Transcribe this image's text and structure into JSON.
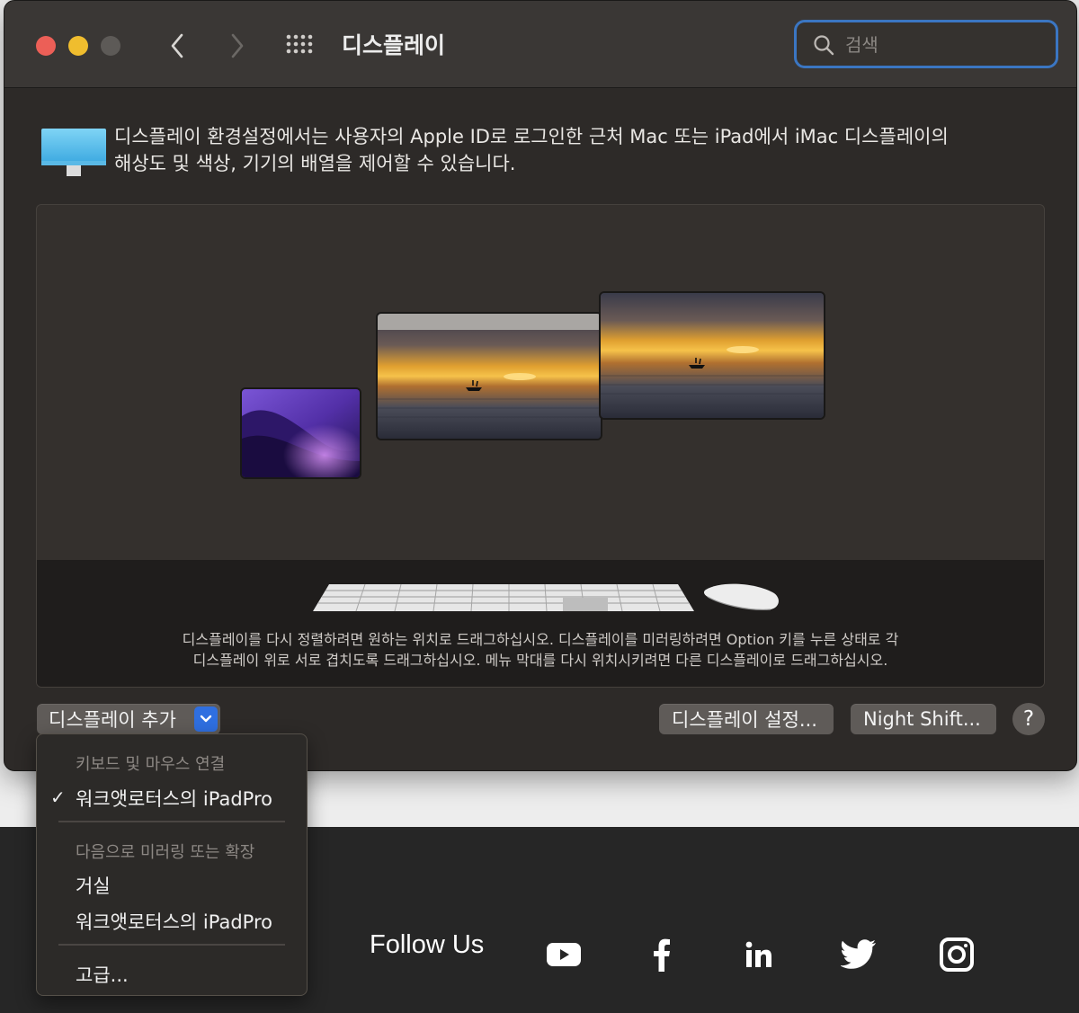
{
  "window": {
    "title": "디스플레이",
    "search_placeholder": "검색"
  },
  "description": {
    "line1": "디스플레이 환경설정에서는 사용자의 Apple ID로 로그인한 근처 Mac 또는 iPad에서 iMac 디스플레이의",
    "line2": "해상도 및 색상, 기기의 배열을 제어할 수 있습니다."
  },
  "arrangement": {
    "hint_line1": "디스플레이를 다시 정렬하려면 원하는 위치로 드래그하십시오. 디스플레이를 미러링하려면 Option 키를 누른 상태로 각",
    "hint_line2": "디스플레이 위로 서로 겹치도록 드래그하십시오. 메뉴 막대를 다시 위치시키려면 다른 디스플레이로 드래그하십시오."
  },
  "buttons": {
    "add_display": "디스플레이 추가",
    "display_settings": "디스플레이 설정...",
    "night_shift": "Night Shift...",
    "help": "?"
  },
  "menu": {
    "section1_header": "키보드 및 마우스 연결",
    "section1_items": [
      "워크앳로터스의 iPadPro"
    ],
    "section1_checked_index": 0,
    "section2_header": "다음으로 미러링 또는 확장",
    "section2_items": [
      "거실",
      "워크앳로터스의 iPadPro"
    ],
    "advanced": "고급..."
  },
  "footer": {
    "follow_us": "Follow Us",
    "socials": [
      "youtube-icon",
      "facebook-icon",
      "linkedin-icon",
      "twitter-icon",
      "instagram-icon"
    ]
  },
  "colors": {
    "accent": "#2f6fe0",
    "close": "#ec5f57",
    "minimize": "#f0bd2e",
    "window_bg": "#2d2a28"
  }
}
